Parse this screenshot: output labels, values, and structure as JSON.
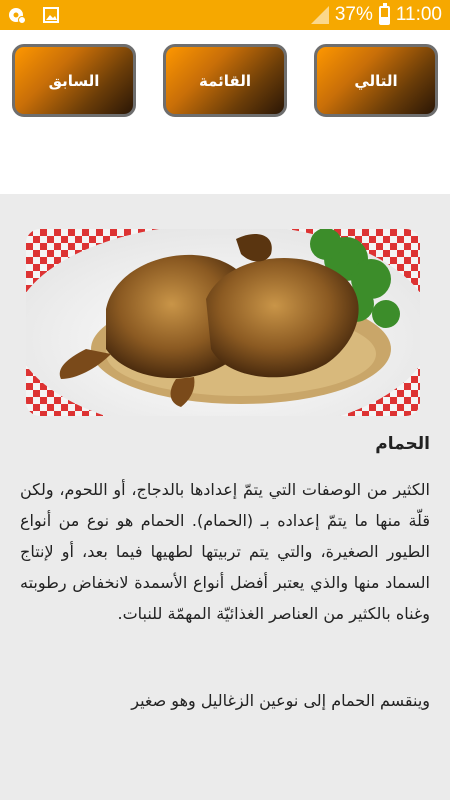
{
  "status_bar": {
    "battery": "37%",
    "time": "11:00",
    "icons": [
      "settings-notification-icon",
      "gallery-icon",
      "signal-icon",
      "battery-icon"
    ]
  },
  "nav": {
    "next_label": "التالي",
    "list_label": "القائمة",
    "prev_label": "السابق"
  },
  "article": {
    "title": "الحمام",
    "paragraph1": "الكثير من الوصفات التي يتمّ إعدادها بالدجاج، أو اللحوم، ولكن قلّة منها ما يتمّ إعداده بـ (الحمام). الحمام هو نوع من أنواع الطيور الصغيرة، والتي يتم تربيتها لطهيها فيما بعد، أو لإنتاج السماد منها والذي يعتبر أفضل أنواع الأسمدة لانخفاض رطوبته وغناه بالكثير من العناصر الغذائيّة المهمّة للنبات.",
    "paragraph2": "وينقسم الحمام إلى نوعين الزغاليل وهو صغير"
  },
  "colors": {
    "status_bar": "#f6a800",
    "button_start": "#fe9700",
    "button_end": "#2a1606",
    "button_border": "#6e6e6e",
    "content_bg": "#ebebeb"
  }
}
